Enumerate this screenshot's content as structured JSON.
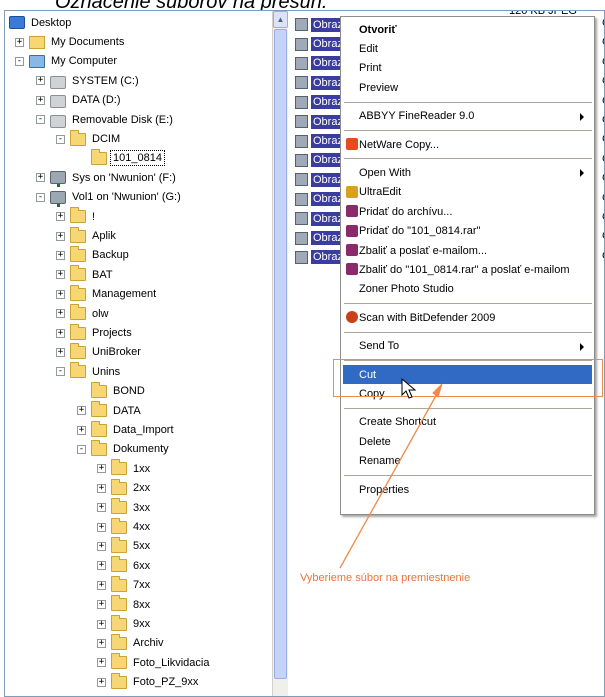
{
  "page_title": "Označenie súborov na presun.",
  "tree": [
    {
      "label": "Desktop",
      "icon": "desktop-icon",
      "indent": 0,
      "expander": "none"
    },
    {
      "label": "My Documents",
      "icon": "my-documents-icon",
      "indent": 1,
      "expander": "+"
    },
    {
      "label": "My Computer",
      "icon": "my-computer-icon",
      "indent": 1,
      "expander": "-"
    },
    {
      "label": "SYSTEM (C:)",
      "icon": "drive-icon",
      "indent": 2,
      "expander": "+"
    },
    {
      "label": "DATA (D:)",
      "icon": "drive-icon",
      "indent": 2,
      "expander": "+"
    },
    {
      "label": "Removable Disk (E:)",
      "icon": "removable-drive-icon",
      "indent": 2,
      "expander": "-"
    },
    {
      "label": "DCIM",
      "icon": "folder-icon",
      "indent": 3,
      "expander": "-"
    },
    {
      "label": "101_0814",
      "icon": "folder-open-icon",
      "indent": 4,
      "expander": "none",
      "selected": true
    },
    {
      "label": "Sys on 'Nwunion' (F:)",
      "icon": "network-drive-icon",
      "indent": 2,
      "expander": "+"
    },
    {
      "label": "Vol1 on 'Nwunion' (G:)",
      "icon": "network-drive-icon",
      "indent": 2,
      "expander": "-"
    },
    {
      "label": "!",
      "icon": "folder-icon",
      "indent": 3,
      "expander": "+"
    },
    {
      "label": "Aplik",
      "icon": "folder-icon",
      "indent": 3,
      "expander": "+"
    },
    {
      "label": "Backup",
      "icon": "folder-icon",
      "indent": 3,
      "expander": "+"
    },
    {
      "label": "BAT",
      "icon": "folder-icon",
      "indent": 3,
      "expander": "+"
    },
    {
      "label": "Management",
      "icon": "folder-icon",
      "indent": 3,
      "expander": "+"
    },
    {
      "label": "olw",
      "icon": "folder-icon",
      "indent": 3,
      "expander": "+"
    },
    {
      "label": "Projects",
      "icon": "folder-icon",
      "indent": 3,
      "expander": "+"
    },
    {
      "label": "UniBroker",
      "icon": "folder-icon",
      "indent": 3,
      "expander": "+"
    },
    {
      "label": "Unins",
      "icon": "folder-icon",
      "indent": 3,
      "expander": "-"
    },
    {
      "label": "BOND",
      "icon": "folder-icon",
      "indent": 4,
      "expander": "none"
    },
    {
      "label": "DATA",
      "icon": "folder-icon",
      "indent": 4,
      "expander": "+"
    },
    {
      "label": "Data_Import",
      "icon": "folder-icon",
      "indent": 4,
      "expander": "+"
    },
    {
      "label": "Dokumenty",
      "icon": "folder-icon",
      "indent": 4,
      "expander": "-"
    },
    {
      "label": "1xx",
      "icon": "folder-icon",
      "indent": 5,
      "expander": "+"
    },
    {
      "label": "2xx",
      "icon": "folder-icon",
      "indent": 5,
      "expander": "+"
    },
    {
      "label": "3xx",
      "icon": "folder-icon",
      "indent": 5,
      "expander": "+"
    },
    {
      "label": "4xx",
      "icon": "folder-icon",
      "indent": 5,
      "expander": "+"
    },
    {
      "label": "5xx",
      "icon": "folder-icon",
      "indent": 5,
      "expander": "+"
    },
    {
      "label": "6xx",
      "icon": "folder-icon",
      "indent": 5,
      "expander": "+"
    },
    {
      "label": "7xx",
      "icon": "folder-icon",
      "indent": 5,
      "expander": "+"
    },
    {
      "label": "8xx",
      "icon": "folder-icon",
      "indent": 5,
      "expander": "+"
    },
    {
      "label": "9xx",
      "icon": "folder-icon",
      "indent": 5,
      "expander": "+"
    },
    {
      "label": "Archiv",
      "icon": "folder-icon",
      "indent": 5,
      "expander": "+"
    },
    {
      "label": "Foto_Likvidacia",
      "icon": "folder-icon",
      "indent": 5,
      "expander": "+"
    },
    {
      "label": "Foto_PZ_9xx",
      "icon": "folder-icon",
      "indent": 5,
      "expander": "+"
    }
  ],
  "file_list": {
    "top_meta": "120 KB   JPEG",
    "files": [
      "Obraz 101_020",
      "Obraz",
      "Obraz",
      "Obraz",
      "Obraz",
      "Obraz",
      "Obraz",
      "Obraz",
      "Obraz",
      "Obraz",
      "Obraz",
      "Obraz",
      "Obraz"
    ],
    "right_meta": [
      "G",
      "G",
      "G",
      "G",
      "G",
      "G",
      "G",
      "G",
      "G",
      "G",
      "G",
      "G",
      "G"
    ]
  },
  "context_menu": [
    {
      "type": "item",
      "label": "Otvoriť",
      "bold": true,
      "name": "menu-open"
    },
    {
      "type": "item",
      "label": "Edit",
      "name": "menu-edit"
    },
    {
      "type": "item",
      "label": "Print",
      "name": "menu-print"
    },
    {
      "type": "item",
      "label": "Preview",
      "name": "menu-preview"
    },
    {
      "type": "sep"
    },
    {
      "type": "item",
      "label": "ABBYY FineReader 9.0",
      "submenu": true,
      "name": "menu-abbyy"
    },
    {
      "type": "sep"
    },
    {
      "type": "item",
      "label": "NetWare Copy...",
      "icon": "netware-icon",
      "name": "menu-netware-copy"
    },
    {
      "type": "sep"
    },
    {
      "type": "item",
      "label": "Open With",
      "submenu": true,
      "name": "menu-open-with"
    },
    {
      "type": "item",
      "label": "UltraEdit",
      "icon": "ultraedit-icon",
      "name": "menu-ultraedit"
    },
    {
      "type": "item",
      "label": "Pridať do archívu...",
      "icon": "winrar-icon",
      "name": "menu-add-archive"
    },
    {
      "type": "item",
      "label": "Pridať do \"101_0814.rar\"",
      "icon": "winrar-icon",
      "name": "menu-add-rar"
    },
    {
      "type": "item",
      "label": "Zbaliť a poslať e-mailom...",
      "icon": "winrar-icon",
      "name": "menu-compress-email"
    },
    {
      "type": "item",
      "label": "Zbaliť do \"101_0814.rar\" a poslať e-mailom",
      "icon": "winrar-icon",
      "name": "menu-compress-rar-email"
    },
    {
      "type": "item",
      "label": "Zoner Photo Studio",
      "name": "menu-zoner"
    },
    {
      "type": "sep"
    },
    {
      "type": "item",
      "label": "Scan with BitDefender 2009",
      "icon": "bitdefender-icon",
      "name": "menu-bitdefender"
    },
    {
      "type": "sep"
    },
    {
      "type": "item",
      "label": "Send To",
      "submenu": true,
      "name": "menu-send-to"
    },
    {
      "type": "sep"
    },
    {
      "type": "item",
      "label": "Cut",
      "highlighted": true,
      "name": "menu-cut"
    },
    {
      "type": "item",
      "label": "Copy",
      "name": "menu-copy"
    },
    {
      "type": "sep"
    },
    {
      "type": "item",
      "label": "Create Shortcut",
      "name": "menu-create-shortcut"
    },
    {
      "type": "item",
      "label": "Delete",
      "name": "menu-delete"
    },
    {
      "type": "item",
      "label": "Rename",
      "name": "menu-rename"
    },
    {
      "type": "sep"
    },
    {
      "type": "item",
      "label": "Properties",
      "name": "menu-properties"
    }
  ],
  "annotation": "Vyberieme súbor na premiestnenie",
  "colors": {
    "highlight": "#316ac5",
    "annotation": "#e8753a",
    "selection": "#3a3c9e"
  }
}
